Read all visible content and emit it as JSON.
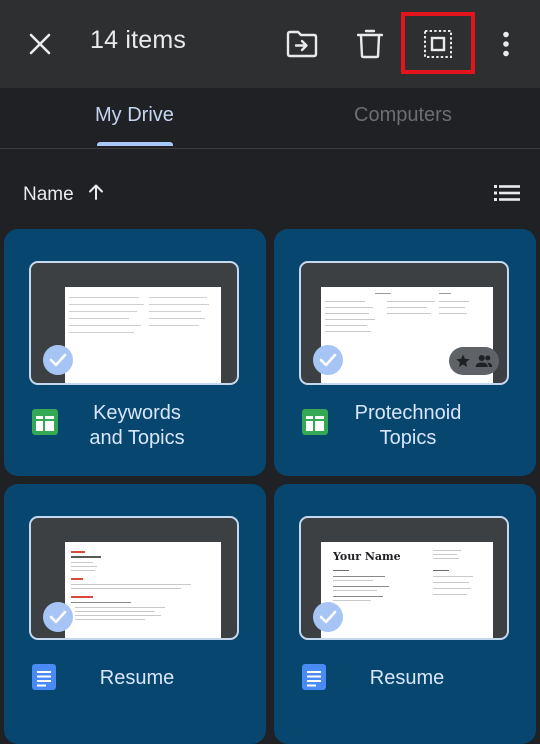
{
  "header": {
    "title": "14 items",
    "icons": [
      "close-icon",
      "move-to-folder-icon",
      "delete-icon",
      "select-all-icon",
      "more-vert-icon"
    ]
  },
  "tabs": [
    {
      "label": "My Drive",
      "active": true
    },
    {
      "label": "Computers",
      "active": false
    }
  ],
  "sort": {
    "label": "Name",
    "direction_icon": "arrow-up-icon",
    "view_icon": "list-view-icon"
  },
  "files": [
    {
      "title_line1": "Keywords",
      "title_line2": "and Topics",
      "type": "sheets",
      "selected": true
    },
    {
      "title_line1": "Protechnoid",
      "title_line2": "Topics",
      "type": "sheets",
      "selected": true,
      "starred": true,
      "shared": true
    },
    {
      "title_line1": "Resume",
      "title_line2": "",
      "type": "docs",
      "selected": true
    },
    {
      "title_line1": "Resume",
      "title_line2": "",
      "type": "docs",
      "selected": true
    }
  ],
  "thumbnails": {
    "resume2_heading": "Your Name"
  },
  "colors": {
    "accent": "#a8c7fa",
    "card_bg": "#07466e",
    "highlight": "#e3141c",
    "sheets_green": "#34a853",
    "docs_blue": "#4a8af4"
  }
}
